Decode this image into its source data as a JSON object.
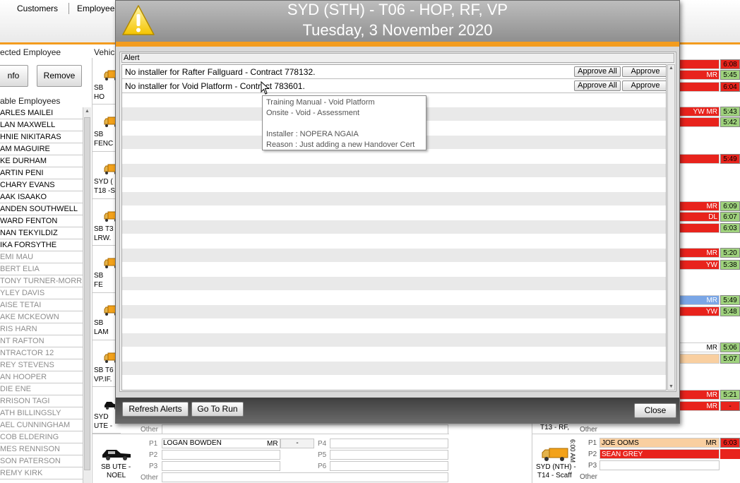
{
  "topbar": {
    "menu": [
      "Customers",
      "Employee"
    ]
  },
  "left": {
    "selected_label": "ected Employee",
    "info_label": "nfo",
    "remove_label": "Remove",
    "available_label": "able Employees",
    "employees": [
      {
        "name": "ARLES MAILEI",
        "active": true
      },
      {
        "name": "LAN MAXWELL",
        "active": true
      },
      {
        "name": "HNIE NIKITARAS",
        "active": true
      },
      {
        "name": "AM MAGUIRE",
        "active": true
      },
      {
        "name": "KE DURHAM",
        "active": true
      },
      {
        "name": "ARTIN PENI",
        "active": true
      },
      {
        "name": "CHARY EVANS",
        "active": true
      },
      {
        "name": "AAK ISAAKO",
        "active": true
      },
      {
        "name": "ANDEN SOUTHWELL",
        "active": true
      },
      {
        "name": "WARD FENTON",
        "active": true
      },
      {
        "name": "NAN TEKYILDIZ",
        "active": true
      },
      {
        "name": "IKA FORSYTHE",
        "active": true
      },
      {
        "name": "EMI MAU",
        "active": false
      },
      {
        "name": "BERT ELIA",
        "active": false
      },
      {
        "name": "TONY TURNER-MORRIS",
        "active": false
      },
      {
        "name": "YLEY DAVIS",
        "active": false
      },
      {
        "name": "AISE TETAI",
        "active": false
      },
      {
        "name": "AKE MCKEOWN",
        "active": false
      },
      {
        "name": "RIS HARN",
        "active": false
      },
      {
        "name": "NT RAFTON",
        "active": false
      },
      {
        "name": "NTRACTOR 12",
        "active": false
      },
      {
        "name": "REY STEVENS",
        "active": false
      },
      {
        "name": "AN HOOPER",
        "active": false
      },
      {
        "name": "DIE ENE",
        "active": false
      },
      {
        "name": "RRISON TAGI",
        "active": false
      },
      {
        "name": "ATH BILLINGSLY",
        "active": false
      },
      {
        "name": "AEL CUNNINGHAM",
        "active": false
      },
      {
        "name": "COB ELDERING",
        "active": false
      },
      {
        "name": "MES RENNISON",
        "active": false
      },
      {
        "name": "SON PATERSON",
        "active": false
      },
      {
        "name": "REMY KIRK",
        "active": false
      }
    ]
  },
  "vehicles": {
    "header": "Vehic",
    "rows": [
      {
        "l1": "SB",
        "l2": "HO"
      },
      {
        "l1": "SB",
        "l2": "FENC"
      },
      {
        "l1": "SYD (",
        "l2": "T18 -S"
      },
      {
        "l1": "SB T3",
        "l2": "LRW."
      },
      {
        "l1": "SB",
        "l2": "FE"
      },
      {
        "l1": "SB",
        "l2": "LAM"
      },
      {
        "l1": "SB T6",
        "l2": "VP.IF."
      },
      {
        "l1": "SYD",
        "l2": "UTE -"
      }
    ]
  },
  "bottom": {
    "other_label": "Other",
    "row2": {
      "vehicle_line1": "SB UTE -",
      "vehicle_line2": "NOEL",
      "p1": "P1",
      "p2": "P2",
      "p3": "P3",
      "p4": "P4",
      "p5": "P5",
      "p6": "P6",
      "p1_name": "LOGAN BOWDEN",
      "p1_tag": "MR",
      "p1_dash": "-"
    }
  },
  "right": {
    "cells": [
      {
        "tag": "",
        "time": "6:08",
        "bg": "#e8231c",
        "tbg": "#e8231c"
      },
      {
        "tag": "MR",
        "time": "5:45",
        "bg": "#e8231c",
        "tbg": "#9fd27d"
      },
      {
        "tag": "",
        "time": "6:04",
        "bg": "#e8231c",
        "tbg": "#e8231c"
      },
      {
        "tag": "YW MR",
        "time": "5:43",
        "bg": "#e8231c",
        "tbg": "#9fd27d"
      },
      {
        "tag": "",
        "time": "5:42",
        "bg": "#e8231c",
        "tbg": "#9fd27d"
      },
      {
        "tag": "",
        "time": "5:49",
        "bg": "#e8231c",
        "tbg": "#e8231c"
      },
      {
        "tag": "MR",
        "time": "6:09",
        "bg": "#e8231c",
        "tbg": "#9fd27d"
      },
      {
        "tag": "DL",
        "time": "6:07",
        "bg": "#e8231c",
        "tbg": "#9fd27d"
      },
      {
        "tag": "",
        "time": "6:03",
        "bg": "#e8231c",
        "tbg": "#9fd27d"
      },
      {
        "tag": "MR",
        "time": "5:20",
        "bg": "#e8231c",
        "tbg": "#9fd27d"
      },
      {
        "tag": "YW",
        "time": "5:38",
        "bg": "#e8231c",
        "tbg": "#9fd27d"
      },
      {
        "tag": "MR",
        "time": "5:49",
        "bg": "#7aa6e6",
        "tbg": "#9fd27d"
      },
      {
        "tag": "YW",
        "time": "5:48",
        "bg": "#e8231c",
        "tbg": "#9fd27d"
      },
      {
        "tag": "MR",
        "time": "5:06",
        "bg": "#ffffff",
        "tbg": "#9fd27d"
      },
      {
        "tag": "",
        "time": "5:07",
        "bg": "#f9cfa0",
        "tbg": "#9fd27d"
      },
      {
        "tag": "MR",
        "time": "5:21",
        "bg": "#e8231c",
        "tbg": "#9fd27d"
      },
      {
        "tag": "MR",
        "time": "-",
        "bg": "#e8231c",
        "tbg": "#e8231c"
      }
    ],
    "t13_label": "T13 - RF,",
    "other_label": "Other",
    "syd_nth": {
      "line1": "SYD (NTH) -",
      "line2": "T14 - Scaff",
      "vertical_time": "6:00 AM",
      "p1": "P1",
      "p1_name": "JOE OOMS",
      "p1_tag": "MR",
      "p1_time": "6:03",
      "p2": "P2",
      "p2_name": "SEAN GREY",
      "p2_time": "",
      "p3": "P3",
      "other": "Other"
    }
  },
  "modal": {
    "title_line1": "SYD (STH) - T06 - HOP, RF, VP",
    "title_line2": "Tuesday, 3 November 2020",
    "grid_header": "Alert",
    "alerts": [
      {
        "message": "No installer for Rafter Fallguard - Contract 778132.",
        "approve_all": "Approve All",
        "approve": "Approve"
      },
      {
        "message": "No installer for Void Platform - Contract 783601.",
        "approve_all": "Approve All",
        "approve": "Approve"
      }
    ],
    "tooltip": {
      "line1": "Training Manual - Void Platform",
      "line2": "Onsite - Void - Assessment",
      "line3": "Installer : NOPERA NGAIA",
      "line4": "Reason : Just adding a new Handover Cert"
    },
    "refresh_label": "Refresh Alerts",
    "goto_label": "Go To Run",
    "close_label": "Close"
  },
  "colors": {
    "accent": "#f39c1e",
    "alert_red": "#e8231c",
    "ok_green": "#9fd27d"
  }
}
